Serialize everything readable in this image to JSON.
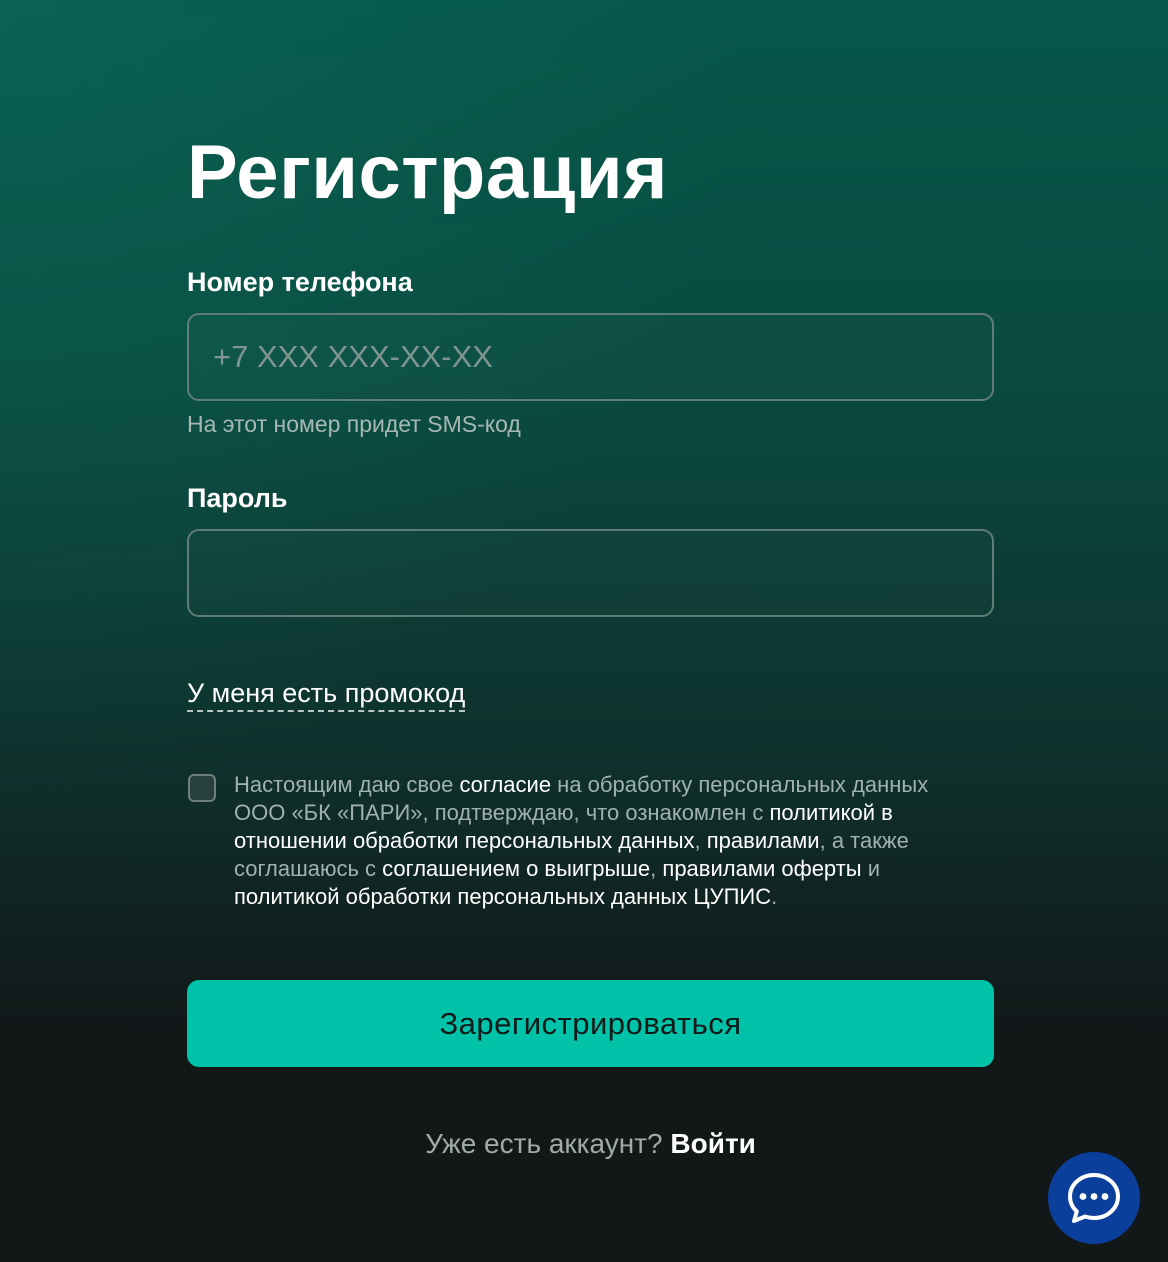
{
  "page": {
    "title": "Регистрация"
  },
  "phone": {
    "label": "Номер телефона",
    "placeholder": "+7 XXX XXX-XX-XX",
    "value": "",
    "hint": "На этот номер придет SMS-код"
  },
  "password": {
    "label": "Пароль",
    "value": ""
  },
  "promo": {
    "link_label": "У меня есть промокод"
  },
  "consent": {
    "checked": false,
    "t1": "Настоящим даю свое ",
    "l1": "согласие",
    "t2": " на обработку персональных данных ООО «БК «ПАРИ», подтверждаю, что ознакомлен с ",
    "l2": "политикой в отношении обработки персональных данных",
    "t3": ", ",
    "l3": "правилами",
    "t4": ", а также соглашаюсь с ",
    "l4": "соглашением о выигрыше",
    "t5": ", ",
    "l5": "правилами оферты",
    "t6": " и ",
    "l6": "политикой обработки персональных данных ЦУПИС",
    "t7": "."
  },
  "submit": {
    "label": "Зарегистрироваться"
  },
  "footer": {
    "question": "Уже есть аккаунт?",
    "login_label": "Войти"
  },
  "chat_widget": {
    "icon": "chat-bubble-icon"
  },
  "colors": {
    "accent": "#00c2a8",
    "chat_button": "#0a3f9c",
    "bg_top": "#06574a",
    "bg_bottom": "#121718"
  }
}
